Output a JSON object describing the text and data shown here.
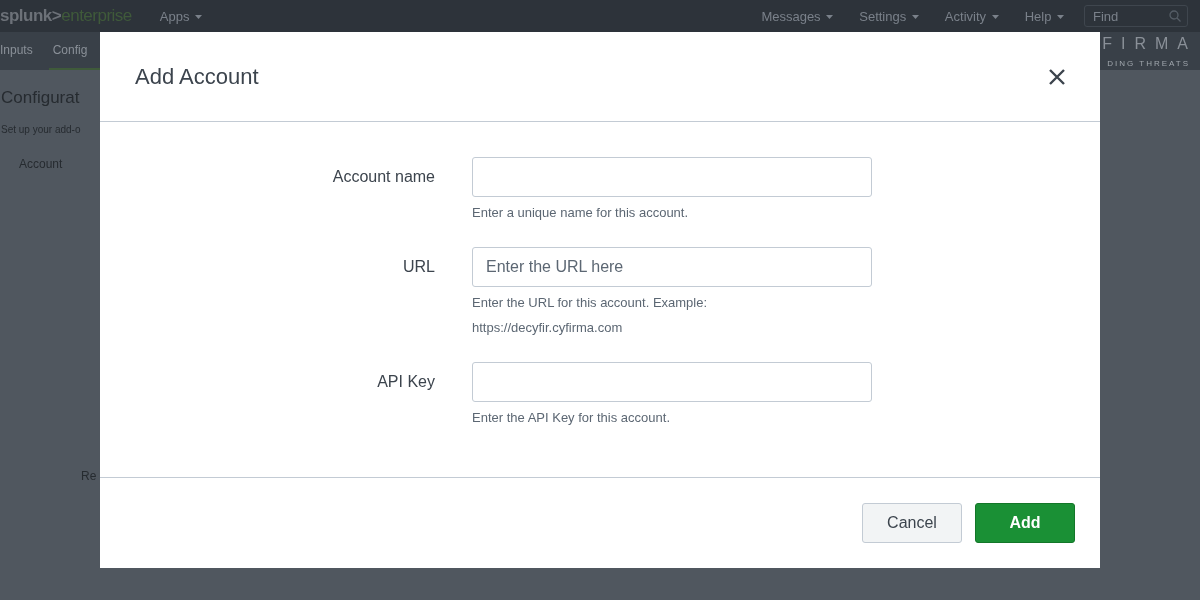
{
  "top_bar": {
    "brand": {
      "main": "splunk>",
      "sub": "enterprise"
    },
    "apps_menu": "Apps",
    "menus": [
      "Messages",
      "Settings",
      "Activity",
      "Help"
    ],
    "search": {
      "placeholder": "Find"
    }
  },
  "app_bar": {
    "tabs": [
      {
        "label": "Inputs",
        "selected": false
      },
      {
        "label": "Config",
        "selected": true
      }
    ],
    "logo": {
      "main": "FIRMA",
      "tagline": "DING THREATS"
    }
  },
  "page": {
    "title": "Configurat",
    "subtitle": "Set up your add-o",
    "tab": "Account",
    "column_text": "Re"
  },
  "dialog": {
    "title": "Add Account",
    "fields": [
      {
        "label": "Account name",
        "help": [
          "Enter a unique name for this account."
        ]
      },
      {
        "label": "URL",
        "placeholder": "Enter the URL here",
        "help": [
          "Enter the URL for this account. Example:",
          "https://decyfir.cyfirma.com"
        ]
      },
      {
        "label": "API Key",
        "help": [
          "Enter the API Key for this account."
        ]
      }
    ],
    "buttons": [
      {
        "label": "Cancel",
        "kind": "secondary"
      },
      {
        "label": "Add",
        "kind": "primary"
      }
    ]
  }
}
